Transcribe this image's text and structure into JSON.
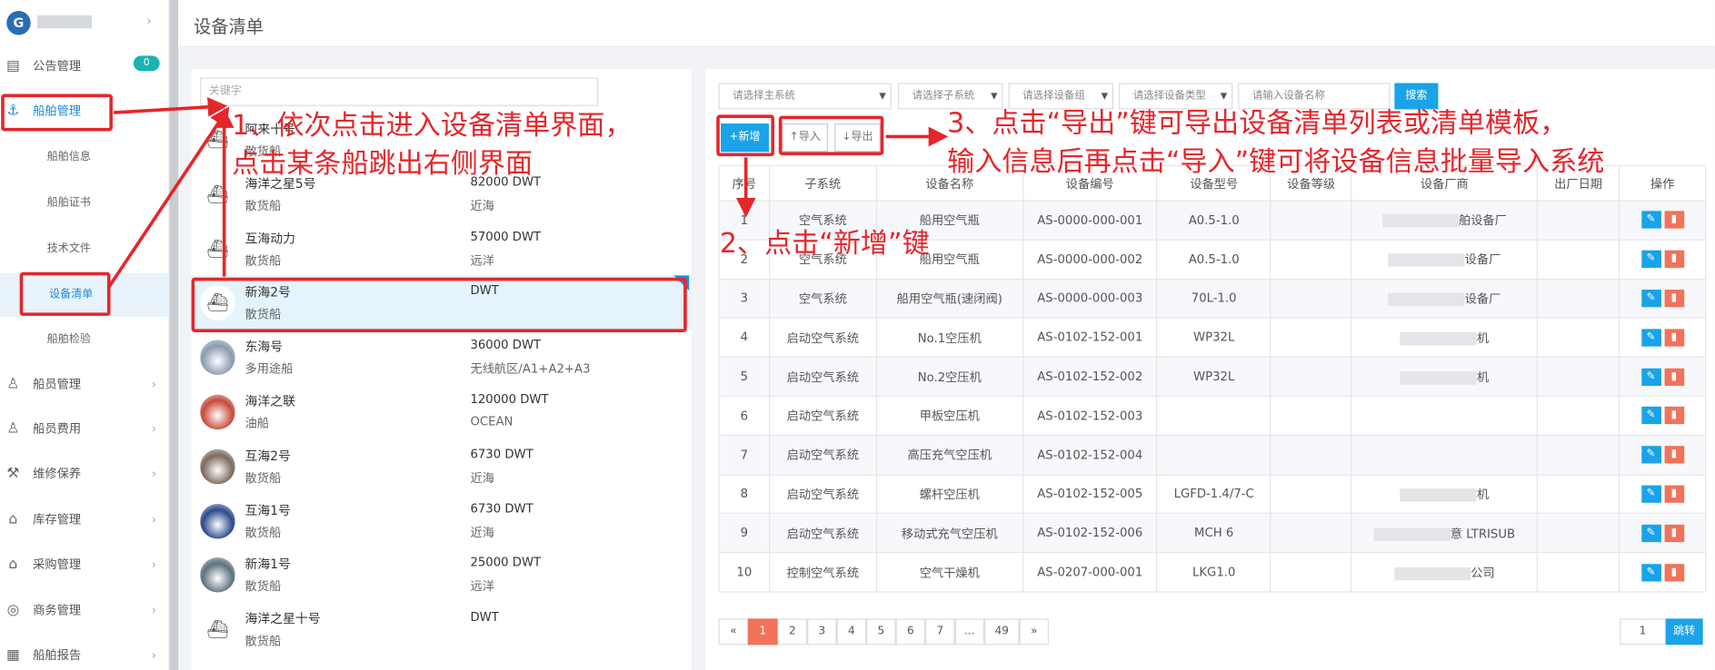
{
  "app": {
    "logo_text": "G"
  },
  "topbar": {
    "title": "设备清单"
  },
  "sidebar": {
    "badge": "0",
    "items": [
      {
        "icon": "book-icon",
        "glyph": "▤",
        "label": "公告管理"
      },
      {
        "icon": "anchor-icon",
        "glyph": "⚓",
        "label": "船舶管理"
      },
      {
        "icon": "user-icon",
        "glyph": "♙",
        "label": "船员管理"
      },
      {
        "icon": "user-money-icon",
        "glyph": "♙",
        "label": "船员费用"
      },
      {
        "icon": "wrench-icon",
        "glyph": "⚒",
        "label": "维修保养"
      },
      {
        "icon": "warehouse-icon",
        "glyph": "⌂",
        "label": "库存管理"
      },
      {
        "icon": "bag-icon",
        "glyph": "⌂",
        "label": "采购管理"
      },
      {
        "icon": "globe-icon",
        "glyph": "◎",
        "label": "商务管理"
      },
      {
        "icon": "calendar-icon",
        "glyph": "▦",
        "label": "船舶报告"
      }
    ],
    "subitems": [
      "船舶信息",
      "船舶证书",
      "技术文件",
      "设备清单",
      "船舶检验"
    ]
  },
  "list": {
    "keyword_placeholder": "关键字",
    "ships": [
      {
        "name": "阿来十号",
        "type": "散货船",
        "dwt": "",
        "area": ""
      },
      {
        "name": "海洋之星5号",
        "type": "散货船",
        "dwt": "82000 DWT",
        "area": "近海"
      },
      {
        "name": "互海动力",
        "type": "散货船",
        "dwt": "57000 DWT",
        "area": "远洋"
      },
      {
        "name": "新海2号",
        "type": "散货船",
        "dwt": "DWT",
        "area": ""
      },
      {
        "name": "东海号",
        "type": "多用途船",
        "dwt": "36000 DWT",
        "area": "无线航区/A1+A2+A3"
      },
      {
        "name": "海洋之联",
        "type": "油船",
        "dwt": "120000 DWT",
        "area": "OCEAN"
      },
      {
        "name": "互海2号",
        "type": "散货船",
        "dwt": "6730 DWT",
        "area": "近海"
      },
      {
        "name": "互海1号",
        "type": "散货船",
        "dwt": "6730 DWT",
        "area": "近海"
      },
      {
        "name": "新海1号",
        "type": "散货船",
        "dwt": "25000 DWT",
        "area": "远洋"
      },
      {
        "name": "海洋之星十号",
        "type": "散货船",
        "dwt": "DWT",
        "area": ""
      }
    ]
  },
  "filters": {
    "main_system": "请选择主系统",
    "sub_system": "请选择子系统",
    "equipment_group": "请选择设备组",
    "equipment_type": "请选择设备类型",
    "equipment_name": "请输入设备名称",
    "search": "搜索"
  },
  "toolbar": {
    "add": "+新增",
    "import": "↑导入",
    "export": "↓导出"
  },
  "table": {
    "headers": [
      "序号",
      "子系统",
      "设备名称",
      "设备编号",
      "设备型号",
      "设备等级",
      "设备厂商",
      "出厂日期",
      "操作"
    ],
    "rows": [
      {
        "no": "1",
        "sub": "空气系统",
        "name": "船用空气瓶",
        "code": "AS-0000-000-001",
        "model": "A0.5-1.0",
        "maker": "舶设备厂"
      },
      {
        "no": "2",
        "sub": "空气系统",
        "name": "船用空气瓶",
        "code": "AS-0000-000-002",
        "model": "A0.5-1.0",
        "maker": "设备厂"
      },
      {
        "no": "3",
        "sub": "空气系统",
        "name": "船用空气瓶(速闭阀)",
        "code": "AS-0000-000-003",
        "model": "70L-1.0",
        "maker": "设备厂"
      },
      {
        "no": "4",
        "sub": "启动空气系统",
        "name": "No.1空压机",
        "code": "AS-0102-152-001",
        "model": "WP32L",
        "maker": "机"
      },
      {
        "no": "5",
        "sub": "启动空气系统",
        "name": "No.2空压机",
        "code": "AS-0102-152-002",
        "model": "WP32L",
        "maker": "机"
      },
      {
        "no": "6",
        "sub": "启动空气系统",
        "name": "甲板空压机",
        "code": "AS-0102-152-003",
        "model": "",
        "maker": ""
      },
      {
        "no": "7",
        "sub": "启动空气系统",
        "name": "高压充气空压机",
        "code": "AS-0102-152-004",
        "model": "",
        "maker": ""
      },
      {
        "no": "8",
        "sub": "启动空气系统",
        "name": "螺杆空压机",
        "code": "AS-0102-152-005",
        "model": "LGFD-1.4/7-C",
        "maker": "机"
      },
      {
        "no": "9",
        "sub": "启动空气系统",
        "name": "移动式充气空压机",
        "code": "AS-0102-152-006",
        "model": "MCH 6",
        "maker": "意 LTRISUB"
      },
      {
        "no": "10",
        "sub": "控制空气系统",
        "name": "空气干燥机",
        "code": "AS-0207-000-001",
        "model": "LKG1.0",
        "maker": "公司"
      }
    ]
  },
  "pagination": {
    "prev": "«",
    "pages": [
      "1",
      "2",
      "3",
      "4",
      "5",
      "6",
      "7",
      "…",
      "49"
    ],
    "next": "»",
    "jump_value": "1",
    "jump": "跳转"
  },
  "annotations": {
    "a1_line1": "1、依次点击进入设备清单界面，",
    "a1_line2": "点击某条船跳出右侧界面",
    "a2": "2、点击“新增”键",
    "a3_line1": "3、点击“导出”键可导出设备清单列表或清单模板，",
    "a3_line2": "输入信息后再点击“导入”键可将设备信息批量导入系统"
  },
  "colors": {
    "accent": "#1aa3e8",
    "danger": "#f0735a",
    "annotation": "#e5262b"
  }
}
